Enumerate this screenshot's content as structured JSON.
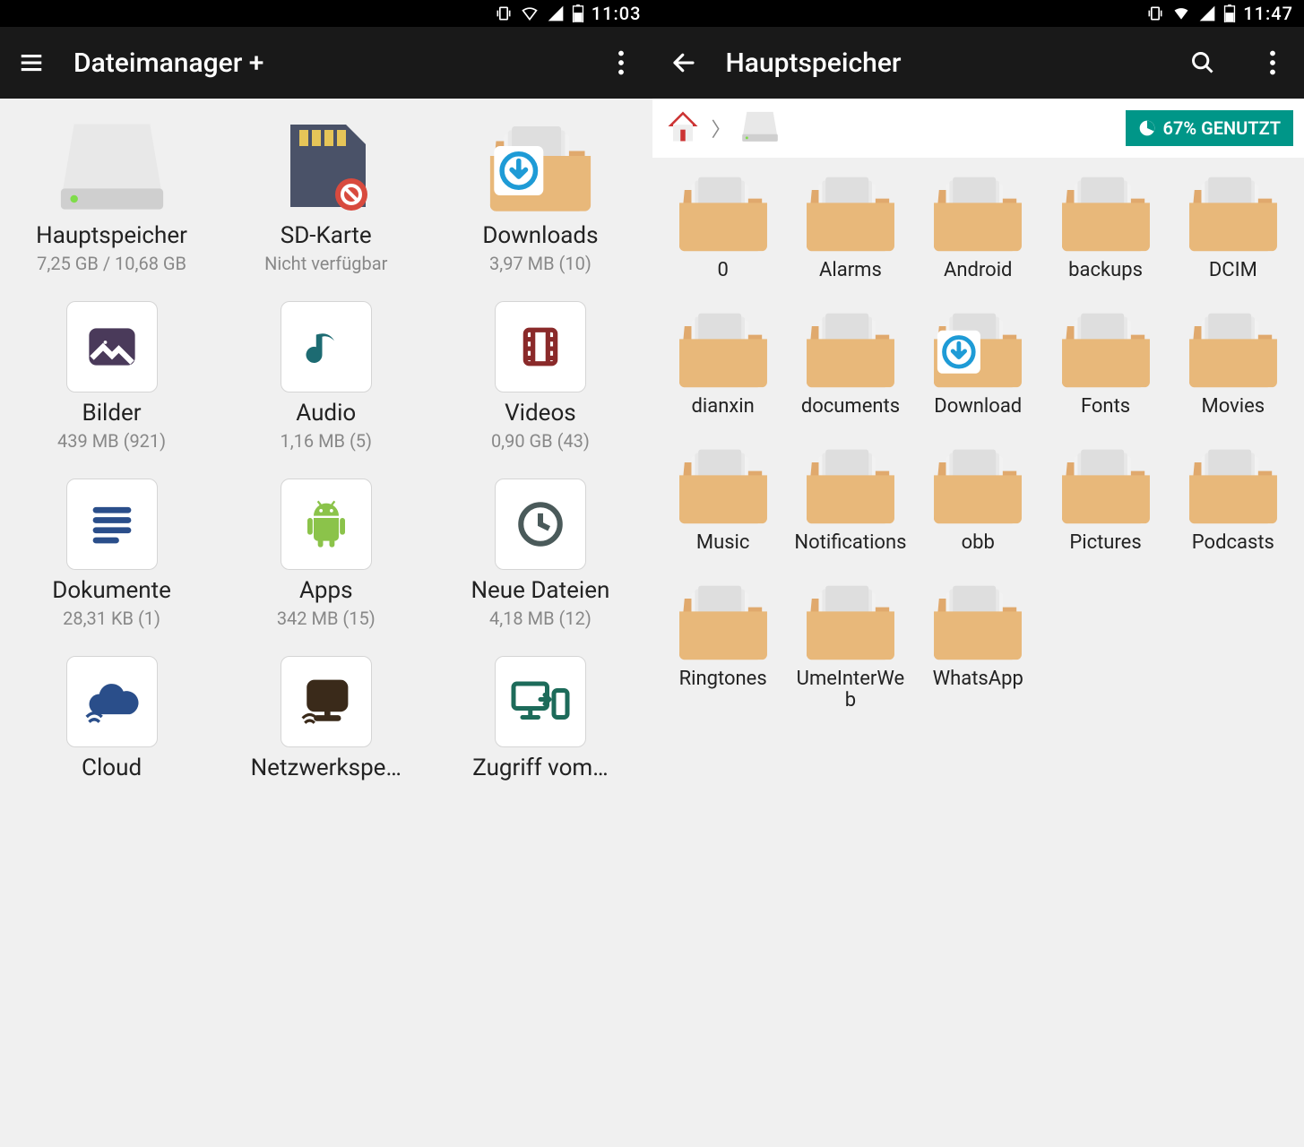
{
  "left": {
    "status": {
      "time": "11:03"
    },
    "appbar": {
      "title": "Dateimanager +"
    },
    "categories": [
      {
        "icon": "hdd",
        "label": "Hauptspeicher",
        "sub": "7,25 GB / 10,68 GB"
      },
      {
        "icon": "sd-blocked",
        "label": "SD-Karte",
        "sub": "Nicht verfügbar"
      },
      {
        "icon": "download-folder",
        "label": "Downloads",
        "sub": "3,97 MB (10)"
      },
      {
        "icon": "images",
        "label": "Bilder",
        "sub": "439 MB (921)"
      },
      {
        "icon": "audio",
        "label": "Audio",
        "sub": "1,16 MB (5)"
      },
      {
        "icon": "videos",
        "label": "Videos",
        "sub": "0,90 GB (43)"
      },
      {
        "icon": "documents",
        "label": "Dokumente",
        "sub": "28,31 KB (1)"
      },
      {
        "icon": "apps",
        "label": "Apps",
        "sub": "342 MB (15)"
      },
      {
        "icon": "recent",
        "label": "Neue Dateien",
        "sub": "4,18 MB (12)"
      },
      {
        "icon": "cloud",
        "label": "Cloud",
        "sub": ""
      },
      {
        "icon": "network",
        "label": "Netzwerkspe…",
        "sub": ""
      },
      {
        "icon": "remote",
        "label": "Zugriff vom…",
        "sub": ""
      }
    ]
  },
  "right": {
    "status": {
      "time": "11:47"
    },
    "appbar": {
      "title": "Hauptspeicher"
    },
    "usage": {
      "label": "67% GENUTZT"
    },
    "folders": [
      {
        "label": "0",
        "icon": "folder"
      },
      {
        "label": "Alarms",
        "icon": "folder"
      },
      {
        "label": "Android",
        "icon": "folder"
      },
      {
        "label": "backups",
        "icon": "folder"
      },
      {
        "label": "DCIM",
        "icon": "folder"
      },
      {
        "label": "dianxin",
        "icon": "folder"
      },
      {
        "label": "documents",
        "icon": "folder"
      },
      {
        "label": "Download",
        "icon": "download-folder"
      },
      {
        "label": "Fonts",
        "icon": "folder"
      },
      {
        "label": "Movies",
        "icon": "folder"
      },
      {
        "label": "Music",
        "icon": "folder"
      },
      {
        "label": "Notifications",
        "icon": "folder"
      },
      {
        "label": "obb",
        "icon": "folder"
      },
      {
        "label": "Pictures",
        "icon": "folder"
      },
      {
        "label": "Podcasts",
        "icon": "folder"
      },
      {
        "label": "Ringtones",
        "icon": "folder"
      },
      {
        "label": "UmeInterWeb",
        "icon": "folder"
      },
      {
        "label": "WhatsApp",
        "icon": "folder"
      }
    ]
  }
}
